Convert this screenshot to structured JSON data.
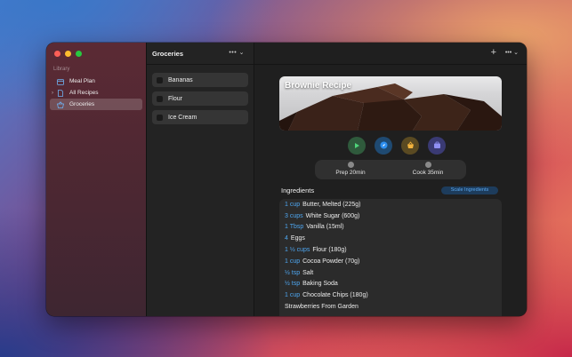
{
  "sidebar": {
    "library_label": "Library",
    "items": [
      {
        "label": "Meal Plan",
        "icon": "calendar-icon",
        "selected": false
      },
      {
        "label": "All Recipes",
        "icon": "document-icon",
        "selected": false
      },
      {
        "label": "Groceries",
        "icon": "basket-icon",
        "selected": true
      }
    ]
  },
  "list": {
    "title": "Groceries",
    "more_label": "••• ⌄",
    "items": [
      "Bananas",
      "Flour",
      "Ice Cream"
    ]
  },
  "detail": {
    "plus_label": "+",
    "more_label": "••• ⌄",
    "recipe_title": "Brownie Recipe",
    "prep_label": "Prep 20min",
    "cook_label": "Cook 35min",
    "ingredients_title": "Ingredients",
    "scale_button": "Scale Ingredients",
    "ingredients": [
      {
        "qty": "1 cup",
        "text": "Butter, Melted (225g)"
      },
      {
        "qty": "3 cups",
        "text": "White Sugar (600g)"
      },
      {
        "qty": "1 Tbsp",
        "text": "Vanilla (15ml)"
      },
      {
        "qty": "4",
        "text": "Eggs"
      },
      {
        "qty": "1 ½ cups",
        "text": "Flour (180g)"
      },
      {
        "qty": "1 cup",
        "text": "Cocoa Powder (70g)"
      },
      {
        "qty": "½ tsp",
        "text": "Salt"
      },
      {
        "qty": "½ tsp",
        "text": "Baking Soda"
      },
      {
        "qty": "1 cup",
        "text": "Chocolate Chips (180g)"
      },
      {
        "qty": "",
        "text": "Strawberries From Garden"
      }
    ]
  },
  "colors": {
    "accent": "#4ea6f0",
    "sidebar_bg": "#4a2732",
    "window_bg": "#1e1e1e"
  }
}
